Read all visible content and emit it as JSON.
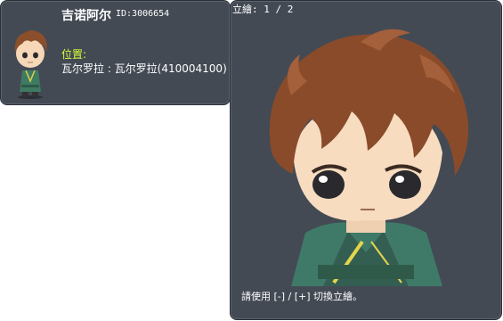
{
  "info": {
    "name": "吉诺阿尔",
    "id_text": "ID:3006654",
    "location_label": "位置:",
    "location_value": "瓦尔罗拉 : 瓦尔罗拉(410004100)"
  },
  "portrait": {
    "page_indicator": "立繪: 1 / 2",
    "hint": "請使用 [-] / [+] 切換立繪。"
  },
  "colors": {
    "panel_bg": "#434a54",
    "location_label": "#d8ff3a"
  }
}
